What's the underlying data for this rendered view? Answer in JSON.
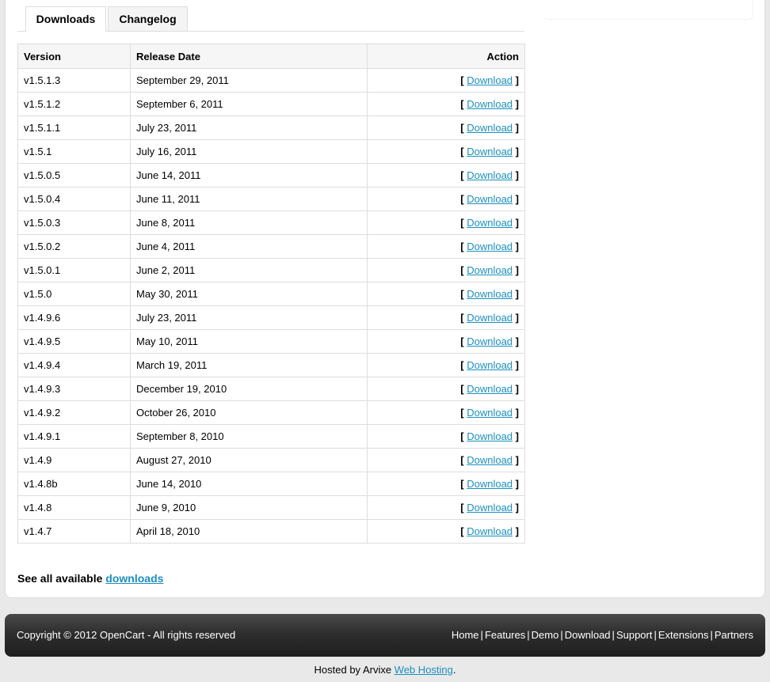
{
  "tabs": [
    {
      "label": "Downloads",
      "active": true
    },
    {
      "label": "Changelog",
      "active": false
    }
  ],
  "table": {
    "headers": {
      "version": "Version",
      "release_date": "Release Date",
      "action": "Action"
    },
    "rows": [
      {
        "version": "v1.5.1.3",
        "date": "September 29, 2011",
        "action": "Download"
      },
      {
        "version": "v1.5.1.2",
        "date": "September 6, 2011",
        "action": "Download"
      },
      {
        "version": "v1.5.1.1",
        "date": "July 23, 2011",
        "action": "Download"
      },
      {
        "version": "v1.5.1",
        "date": "July 16, 2011",
        "action": "Download"
      },
      {
        "version": "v1.5.0.5",
        "date": "June 14, 2011",
        "action": "Download"
      },
      {
        "version": "v1.5.0.4",
        "date": "June 11, 2011",
        "action": "Download"
      },
      {
        "version": "v1.5.0.3",
        "date": "June 8, 2011",
        "action": "Download"
      },
      {
        "version": "v1.5.0.2",
        "date": "June 4, 2011",
        "action": "Download"
      },
      {
        "version": "v1.5.0.1",
        "date": "June 2, 2011",
        "action": "Download"
      },
      {
        "version": "v1.5.0",
        "date": "May 30, 2011",
        "action": "Download"
      },
      {
        "version": "v1.4.9.6",
        "date": "July 23, 2011",
        "action": "Download"
      },
      {
        "version": "v1.4.9.5",
        "date": "May 10, 2011",
        "action": "Download"
      },
      {
        "version": "v1.4.9.4",
        "date": "March 19, 2011",
        "action": "Download"
      },
      {
        "version": "v1.4.9.3",
        "date": "December 19, 2010",
        "action": "Download"
      },
      {
        "version": "v1.4.9.2",
        "date": "October 26, 2010",
        "action": "Download"
      },
      {
        "version": "v1.4.9.1",
        "date": "September 8, 2010",
        "action": "Download"
      },
      {
        "version": "v1.4.9",
        "date": "August 27, 2010",
        "action": "Download"
      },
      {
        "version": "v1.4.8b",
        "date": "June 14, 2010",
        "action": "Download"
      },
      {
        "version": "v1.4.8",
        "date": "June 9, 2010",
        "action": "Download"
      },
      {
        "version": "v1.4.7",
        "date": "April 18, 2010",
        "action": "Download"
      }
    ]
  },
  "see_all": {
    "prefix": "See all available ",
    "link": "downloads"
  },
  "footer": {
    "copyright": "Copyright © 2012 OpenCart - All rights reserved",
    "nav": [
      "Home",
      "Features",
      "Demo",
      "Download",
      "Support",
      "Extensions",
      "Partners"
    ]
  },
  "hosted": {
    "prefix": "Hosted by Arvixe ",
    "link": "Web Hosting",
    "suffix": "."
  },
  "colors": {
    "link": "#1b8fc0",
    "footer_bg": "#2e2e2e",
    "page_bg": "#e9e9e9"
  }
}
